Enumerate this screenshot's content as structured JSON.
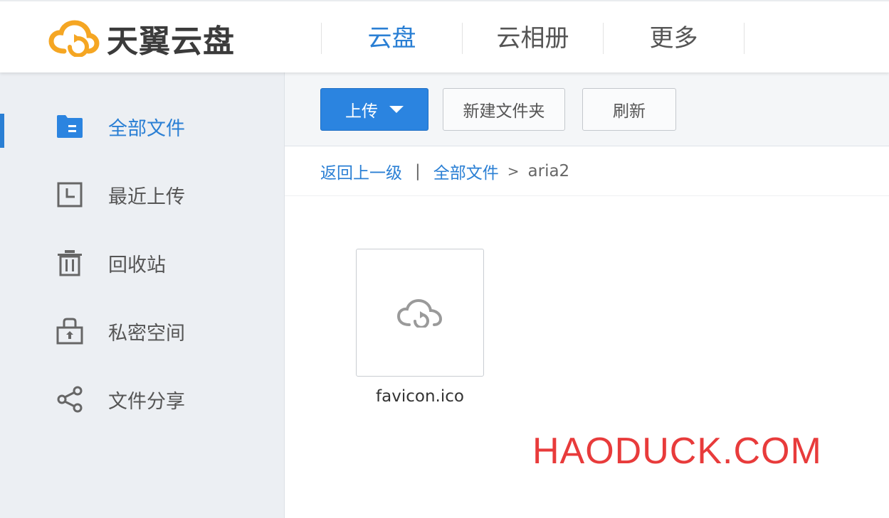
{
  "brand": {
    "logo_text": "天翼云盘",
    "accent_color": "#2a7fd4",
    "logo_color": "#f5a623"
  },
  "nav": {
    "items": [
      {
        "label": "云盘",
        "active": true
      },
      {
        "label": "云相册",
        "active": false
      },
      {
        "label": "更多",
        "active": false
      }
    ]
  },
  "sidebar": {
    "items": [
      {
        "label": "全部文件",
        "icon": "folder-icon",
        "active": true
      },
      {
        "label": "最近上传",
        "icon": "clock-icon",
        "active": false
      },
      {
        "label": "回收站",
        "icon": "trash-icon",
        "active": false
      },
      {
        "label": "私密空间",
        "icon": "lock-icon",
        "active": false
      },
      {
        "label": "文件分享",
        "icon": "share-icon",
        "active": false
      }
    ]
  },
  "toolbar": {
    "upload_label": "上传",
    "new_folder_label": "新建文件夹",
    "refresh_label": "刷新"
  },
  "breadcrumb": {
    "back_label": "返回上一级",
    "separator": "|",
    "root_label": "全部文件",
    "arrow": ">",
    "current": "aria2"
  },
  "files": [
    {
      "name": "favicon.ico",
      "icon": "cloud-file-icon"
    }
  ],
  "watermark": "HAODUCK.COM"
}
